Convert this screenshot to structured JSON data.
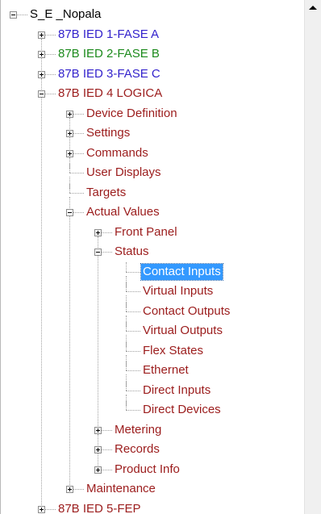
{
  "colors": {
    "dark_red": "#9b1c1c",
    "black": "#000000",
    "blue": "#3322cc",
    "green": "#1c8a1c",
    "selection": "#3399ff"
  },
  "tree": {
    "items": [
      {
        "label": "S_E _Nopala",
        "depth": 0,
        "expander": "minus",
        "color": "black"
      },
      {
        "label": "87B IED 1-FASE A",
        "depth": 1,
        "expander": "plus",
        "color": "blue"
      },
      {
        "label": "87B IED 2-FASE B",
        "depth": 1,
        "expander": "plus",
        "color": "green"
      },
      {
        "label": "87B IED 3-FASE C",
        "depth": 1,
        "expander": "plus",
        "color": "blue"
      },
      {
        "label": "87B IED 4 LOGICA",
        "depth": 1,
        "expander": "minus",
        "color": "dark_red"
      },
      {
        "label": "Device Definition",
        "depth": 2,
        "expander": "plus",
        "color": "dark_red"
      },
      {
        "label": "Settings",
        "depth": 2,
        "expander": "plus",
        "color": "dark_red"
      },
      {
        "label": "Commands",
        "depth": 2,
        "expander": "plus",
        "color": "dark_red"
      },
      {
        "label": "User Displays",
        "depth": 2,
        "expander": "none",
        "color": "dark_red"
      },
      {
        "label": "Targets",
        "depth": 2,
        "expander": "none",
        "color": "dark_red"
      },
      {
        "label": "Actual Values",
        "depth": 2,
        "expander": "minus",
        "color": "dark_red"
      },
      {
        "label": "Front Panel",
        "depth": 3,
        "expander": "plus",
        "color": "dark_red"
      },
      {
        "label": "Status",
        "depth": 3,
        "expander": "minus",
        "color": "dark_red"
      },
      {
        "label": "Contact Inputs",
        "depth": 4,
        "expander": "none",
        "color": "dark_red",
        "selected": true
      },
      {
        "label": "Virtual Inputs",
        "depth": 4,
        "expander": "none",
        "color": "dark_red"
      },
      {
        "label": "Contact Outputs",
        "depth": 4,
        "expander": "none",
        "color": "dark_red"
      },
      {
        "label": "Virtual Outputs",
        "depth": 4,
        "expander": "none",
        "color": "dark_red"
      },
      {
        "label": "Flex States",
        "depth": 4,
        "expander": "none",
        "color": "dark_red"
      },
      {
        "label": "Ethernet",
        "depth": 4,
        "expander": "none",
        "color": "dark_red"
      },
      {
        "label": "Direct Inputs",
        "depth": 4,
        "expander": "none",
        "color": "dark_red"
      },
      {
        "label": "Direct Devices",
        "depth": 4,
        "expander": "none",
        "color": "dark_red"
      },
      {
        "label": "Metering",
        "depth": 3,
        "expander": "plus",
        "color": "dark_red"
      },
      {
        "label": "Records",
        "depth": 3,
        "expander": "plus",
        "color": "dark_red"
      },
      {
        "label": "Product Info",
        "depth": 3,
        "expander": "plus",
        "color": "dark_red"
      },
      {
        "label": "Maintenance",
        "depth": 2,
        "expander": "plus",
        "color": "dark_red"
      },
      {
        "label": "87B IED 5-FEP",
        "depth": 1,
        "expander": "plus",
        "color": "dark_red"
      }
    ]
  },
  "scrollbar": {
    "up_icon": "triangle-up-icon"
  }
}
